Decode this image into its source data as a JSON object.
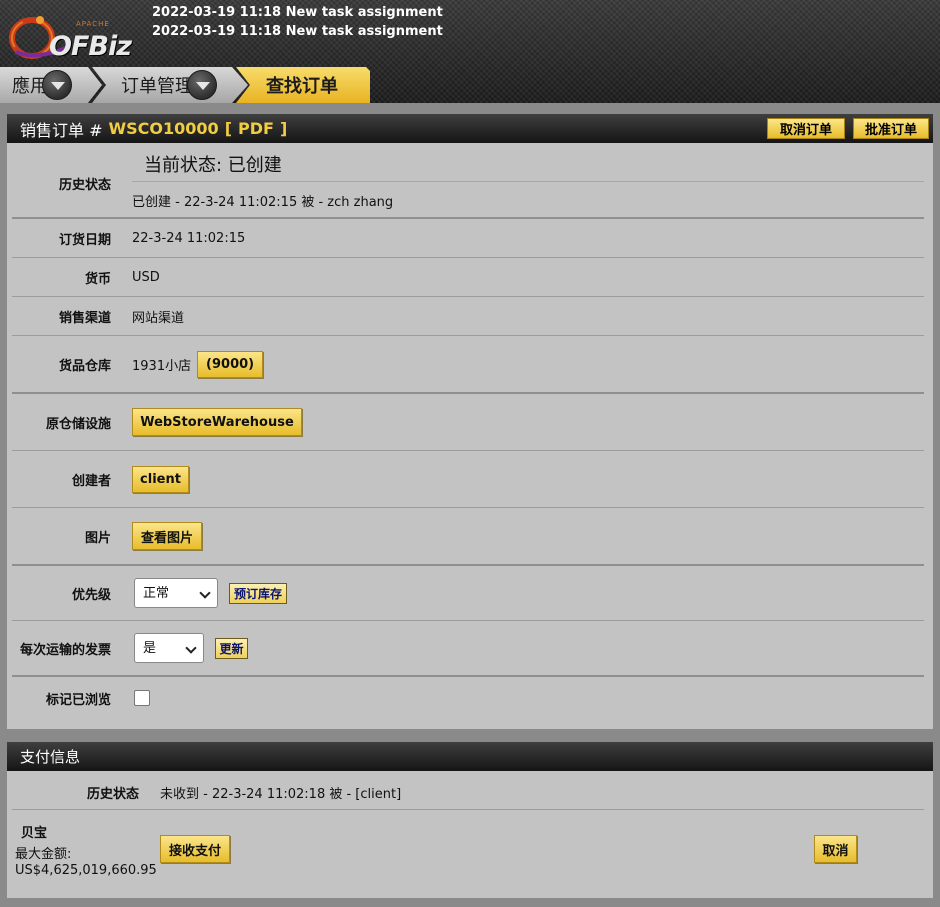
{
  "header": {
    "logo_text": "OFBiz",
    "logo_sub": "APACHE",
    "notices": [
      "2022-03-19 11:18 New task assignment",
      "2022-03-19 11:18 New task assignment"
    ]
  },
  "tabs": [
    {
      "label": "應用"
    },
    {
      "label": "订单管理"
    },
    {
      "label": "查找订单"
    }
  ],
  "order": {
    "title_prefix": "销售订单 #",
    "order_id": "WSCO10000",
    "bracket_open": "[",
    "pdf_link": "PDF",
    "bracket_close": "]",
    "cancel_order_label": "取消订单",
    "approve_order_label": "批准订单",
    "history_label": "历史状态",
    "current_status": "当前状态: 已创建",
    "history_entry": "已创建 - 22-3-24 11:02:15   被 - zch zhang",
    "order_date_label": "订货日期",
    "order_date": "22-3-24 11:02:15",
    "currency_label": "货币",
    "currency": "USD",
    "channel_label": "销售渠道",
    "channel": "网站渠道",
    "store_label": "货品仓库",
    "store_name": "1931小店",
    "store_id_button": "(9000)",
    "facility_label": "原仓储设施",
    "facility_button": "WebStoreWarehouse",
    "creator_label": "创建者",
    "creator_button": "client",
    "image_label": "图片",
    "image_button": "查看图片",
    "priority_label": "优先级",
    "priority_value": "正常",
    "reserve_button": "预订库存",
    "invoice_label": "每次运输的发票",
    "invoice_value": "是",
    "update_button": "更新",
    "viewed_label": "标记已浏览",
    "viewed_checked": false
  },
  "payment": {
    "title": "支付信息",
    "history_label": "历史状态",
    "history_entry": "未收到 - 22-3-24 11:02:18   被 - [client]",
    "method_name": "贝宝",
    "max_amount_label": "最大金额:",
    "max_amount": "US$4,625,019,660.95",
    "receive_button": "接收支付",
    "cancel_button": "取消"
  },
  "colors": {
    "accent_yellow": "#f2cd42",
    "panel_bg": "#c3c3c3",
    "bar_dark": "#151515"
  },
  "icons": [
    "dropdown-arrow-icon",
    "checkbox-icon"
  ]
}
